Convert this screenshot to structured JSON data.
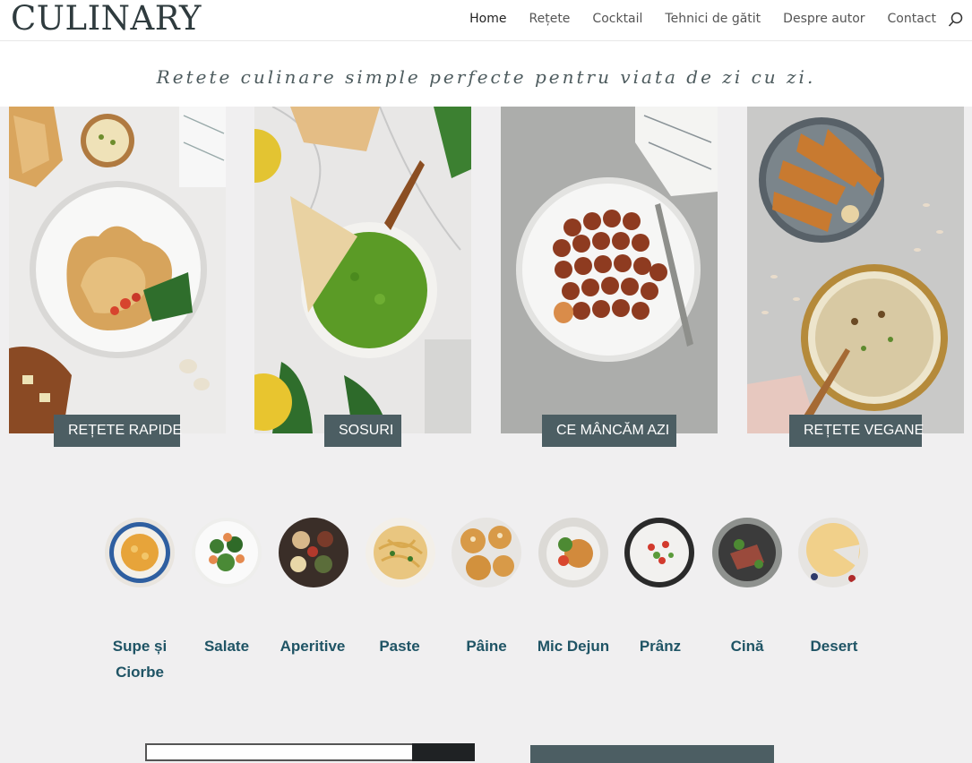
{
  "header": {
    "logo": "CULINARY",
    "nav": [
      "Home",
      "Rețete",
      "Cocktail",
      "Tehnici de gătit",
      "Despre autor",
      "Contact"
    ],
    "active_index": 0,
    "search_icon": "search-icon"
  },
  "tagline": "Retete culinare simple perfecte pentru viata de zi cu zi.",
  "cards": [
    {
      "label": "REȚETE RAPIDE",
      "image": "flatbread-plate"
    },
    {
      "label": "SOSURI",
      "image": "green-sauce-bowl"
    },
    {
      "label": "CE MÂNCĂM AZI",
      "image": "meatballs-plate"
    },
    {
      "label": "REȚETE VEGANE",
      "image": "vegan-soup-toast"
    }
  ],
  "categories": [
    {
      "line1": "Supe și",
      "line2": "Ciorbe",
      "image": "soup-bowl"
    },
    {
      "line1": "Salate",
      "line2": "",
      "image": "shrimp-salad"
    },
    {
      "line1": "Aperitive",
      "line2": "",
      "image": "appetizer-board"
    },
    {
      "line1": "Paste",
      "line2": "",
      "image": "pasta-plate"
    },
    {
      "line1": "Pâine",
      "line2": "",
      "image": "bread-buns"
    },
    {
      "line1": "Mic Dejun",
      "line2": "",
      "image": "breakfast-plate"
    },
    {
      "line1": "Prânz",
      "line2": "",
      "image": "lunch-bowl"
    },
    {
      "line1": "Cină",
      "line2": "",
      "image": "steak-dinner"
    },
    {
      "line1": "Desert",
      "line2": "",
      "image": "cheesecake"
    }
  ],
  "colors": {
    "accent": "#4c5e63",
    "category_text": "#1f5465",
    "background": "#f0eff0"
  }
}
